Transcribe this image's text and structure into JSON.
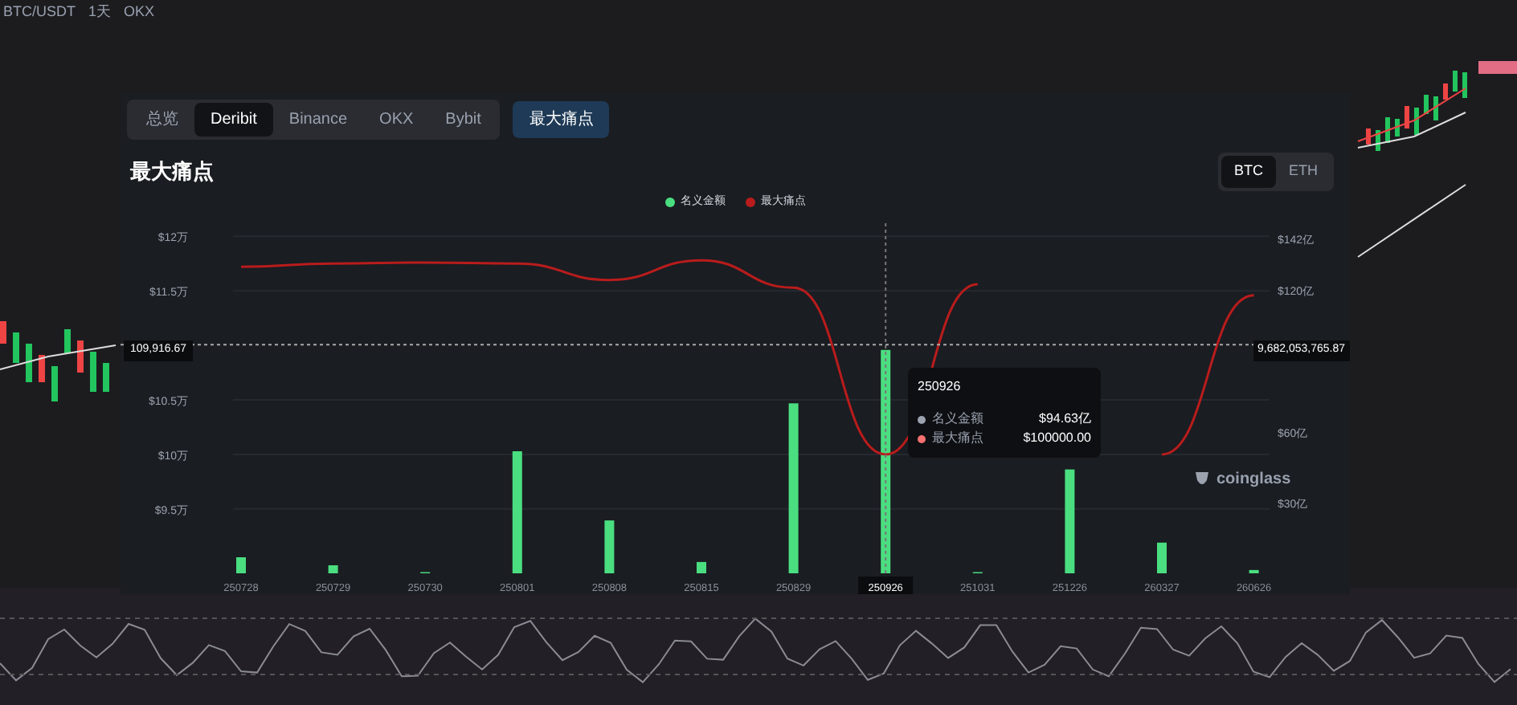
{
  "chart_header": {
    "symbol": "BTC/USDT",
    "interval": "1天",
    "exchange": "OKX"
  },
  "panel": {
    "tabs": [
      {
        "label": "总览",
        "selected": false
      },
      {
        "label": "Deribit",
        "selected": true
      },
      {
        "label": "Binance",
        "selected": false
      },
      {
        "label": "OKX",
        "selected": false
      },
      {
        "label": "Bybit",
        "selected": false
      }
    ],
    "special_tab": {
      "label": "最大痛点",
      "selected": true
    },
    "title": "最大痛点",
    "coins": [
      {
        "label": "BTC",
        "selected": true
      },
      {
        "label": "ETH",
        "selected": false
      }
    ],
    "chart_data": {
      "type": "bar",
      "grid": true,
      "categories": [
        "250728",
        "250729",
        "250730",
        "250801",
        "250808",
        "250815",
        "250829",
        "250926",
        "251031",
        "251226",
        "260327",
        "260626"
      ],
      "series": [
        {
          "name": "名义金额",
          "color": "#4ade80",
          "type": "bar",
          "values": [
            6.8,
            3.4,
            0.5,
            51.7,
            22.4,
            4.8,
            72,
            94.63,
            0.5,
            44,
            13,
            1.4
          ]
        },
        {
          "name": "最大痛点",
          "color": "#b91c1c",
          "type": "line",
          "axis": "y2",
          "values": [
            11.72,
            11.75,
            11.76,
            11.75,
            11.6,
            11.78,
            11.53,
            10.0,
            11.56,
            null,
            10.0,
            11.46
          ]
        }
      ],
      "ref_lines": [
        {
          "axis": "x",
          "value": "250926"
        },
        {
          "axis": "y",
          "value": 96.82
        }
      ],
      "ylim": [
        0,
        148.3
      ],
      "yticks": [
        {
          "value": 142,
          "label": "$142亿"
        },
        {
          "value": 120,
          "label": "$120亿"
        },
        {
          "value": 60,
          "label": "$60亿"
        },
        {
          "value": 30,
          "label": "$30亿"
        }
      ],
      "y2lim": [
        8.91,
        12.12
      ],
      "y2ticks": [
        {
          "value": 12,
          "label": "$12万"
        },
        {
          "value": 11.5,
          "label": "$11.5万"
        },
        {
          "value": 10.5,
          "label": "$10.5万"
        },
        {
          "value": 10,
          "label": "$10万"
        },
        {
          "value": 9.5,
          "label": "$9.5万"
        }
      ]
    },
    "category_states": [
      {
        "selected": false
      },
      {
        "selected": false
      },
      {
        "selected": false
      },
      {
        "selected": false
      },
      {
        "selected": false
      },
      {
        "selected": false
      },
      {
        "selected": false
      },
      {
        "selected": true
      },
      {
        "selected": false
      },
      {
        "selected": false
      },
      {
        "selected": false
      },
      {
        "selected": false
      }
    ],
    "crosshair": {
      "left_label": "109,916.67",
      "right_label": "9,682,053,765.87"
    },
    "tooltip": {
      "title": "250926",
      "rows": [
        {
          "name": "名义金额",
          "value": "$94.63亿",
          "color": "#9ca3af"
        },
        {
          "name": "最大痛点",
          "value": "$100000.00",
          "color": "#f87171"
        }
      ]
    },
    "brand": "coinglass"
  }
}
